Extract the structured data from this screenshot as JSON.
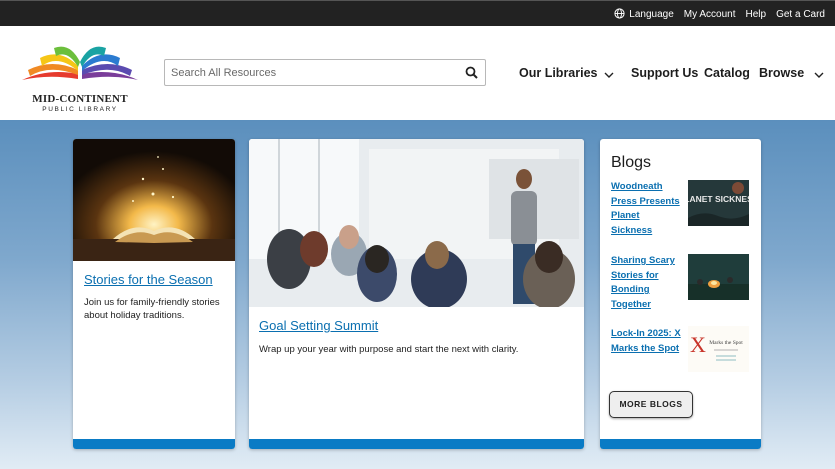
{
  "utility_nav": {
    "language": "Language",
    "my_account": "My Account",
    "help": "Help",
    "get_card": "Get a Card"
  },
  "logo": {
    "name": "MID-CONTINENT",
    "tagline": "PUBLIC LIBRARY"
  },
  "search": {
    "placeholder": "Search All Resources"
  },
  "main_nav": {
    "our_libraries": "Our Libraries",
    "support_us": "Support Us",
    "catalog": "Catalog",
    "browse": "Browse"
  },
  "featured": [
    {
      "title": "Stories for the Season",
      "description": "Join us for family-friendly stories about holiday traditions."
    },
    {
      "title": "Goal Setting Summit",
      "description": "Wrap up your year with purpose and start the next with clarity."
    }
  ],
  "blogs": {
    "heading": "Blogs",
    "items": [
      {
        "title": "Woodneath Press Presents Planet Sickness",
        "thumb_text": "PLANET SICKNESS"
      },
      {
        "title": "Sharing Scary Stories for Bonding Together",
        "thumb_text": ""
      },
      {
        "title": "Lock-In 2025: X Marks the Spot",
        "thumb_text": "Marks the Spot"
      }
    ],
    "more_label": "MORE BLOGS"
  },
  "colors": {
    "accent_blue": "#0a7bc5",
    "link_blue": "#0a6fb0",
    "topbar": "#222222"
  }
}
